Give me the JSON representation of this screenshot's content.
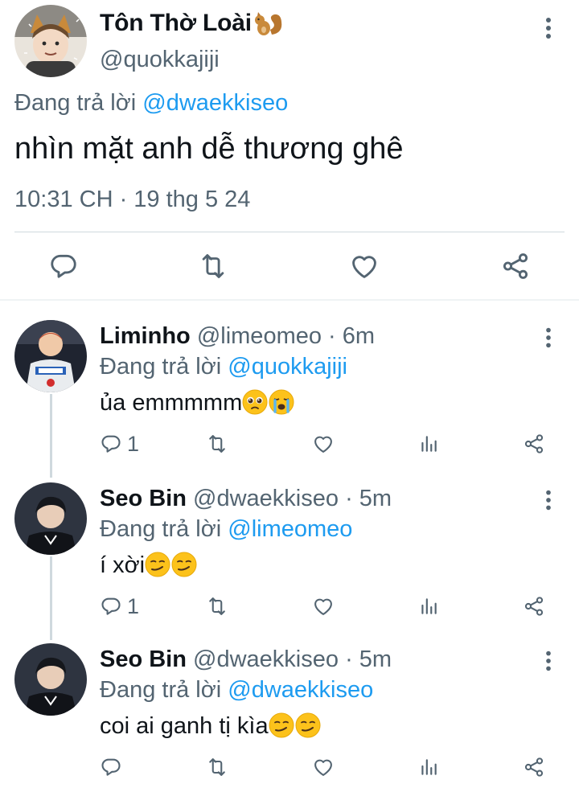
{
  "main_tweet": {
    "display_name": "Tôn Thờ Loài",
    "handle": "@quokkajiji",
    "replying_label": "Đang trả lời",
    "replying_to": "@dwaekkiseo",
    "text": "nhìn mặt anh dễ thương ghê",
    "timestamp": "10:31 CH · 19 thg 5 24"
  },
  "replies": [
    {
      "display_name": "Liminho",
      "handle": "@limeomeo",
      "time": "· 6m",
      "replying_label": "Đang trả lời",
      "replying_to": "@quokkajiji",
      "text": "ủa emmmmm",
      "reply_count": "1"
    },
    {
      "display_name": "Seo Bin",
      "handle": "@dwaekkiseo",
      "time": "· 5m",
      "replying_label": "Đang trả lời",
      "replying_to": "@limeomeo",
      "text": "í xời",
      "reply_count": "1"
    },
    {
      "display_name": "Seo Bin",
      "handle": "@dwaekkiseo",
      "time": "· 5m",
      "replying_label": "Đang trả lời",
      "replying_to": "@dwaekkiseo",
      "text": "coi ai ganh tị kìa",
      "reply_count": ""
    }
  ],
  "icons": {
    "badge": "squirrel-icon",
    "more": "more-vertical-icon",
    "reply": "comment-icon",
    "retweet": "retweet-icon",
    "like": "heart-icon",
    "views": "views-chart-icon",
    "share": "share-icon",
    "reply_1_emoji": [
      "pleading-face-emoji",
      "crying-face-emoji"
    ],
    "reply_2_emoji": [
      "smirk-face-emoji",
      "smirk-face-emoji"
    ],
    "reply_3_emoji": [
      "smirk-face-emoji",
      "smirk-face-emoji"
    ]
  },
  "colors": {
    "link": "#1d9bf0",
    "muted": "#536471",
    "text": "#0f1419",
    "divider": "#cfd9de"
  }
}
